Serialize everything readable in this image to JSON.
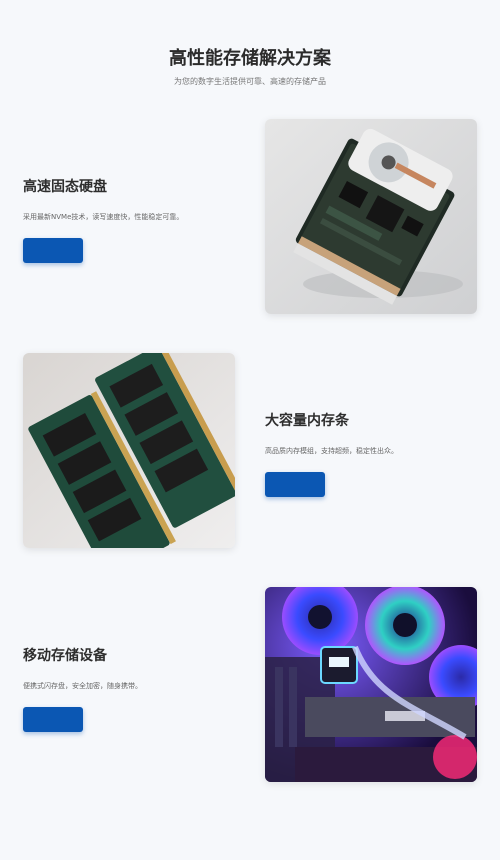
{
  "header": {
    "title": "高性能存储解决方案",
    "subtitle": "为您的数字生活提供可靠、高速的存储产品"
  },
  "products": [
    {
      "title": "高速固态硬盘",
      "description": "采用最新NVMe技术，读写速度快，性能稳定可靠。",
      "button_label": "",
      "image": "hard-drive-photo"
    },
    {
      "title": "大容量内存条",
      "description": "高品质内存模组，支持超频，稳定性出众。",
      "button_label": "",
      "image": "ram-module-photo"
    },
    {
      "title": "移动存储设备",
      "description": "便携式闪存盘，安全加密，随身携带。",
      "button_label": "",
      "image": "rgb-pc-interior-photo"
    }
  ],
  "colors": {
    "background": "#f6f8fb",
    "button": "#0b57b3",
    "title": "#2b2b2b"
  }
}
